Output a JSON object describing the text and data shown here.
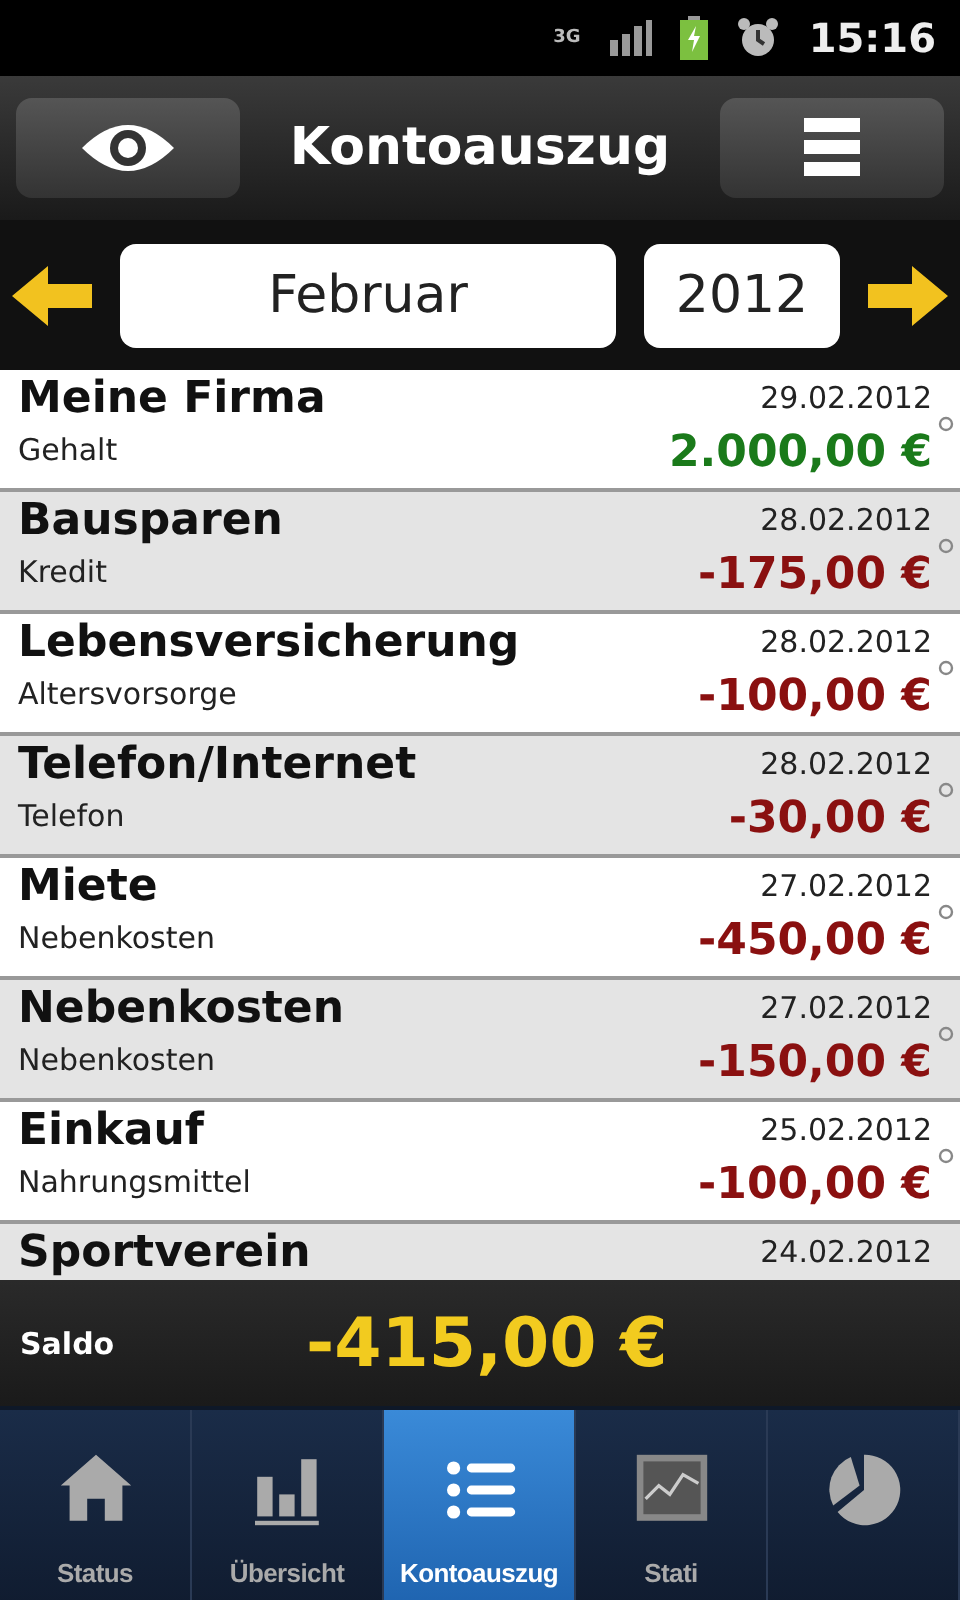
{
  "status_bar": {
    "network": "3G",
    "time": "15:16"
  },
  "toolbar": {
    "title": "Kontoauszug"
  },
  "period": {
    "month": "Februar",
    "year": "2012"
  },
  "transactions": [
    {
      "payee": "Meine Firma",
      "category": "Gehalt",
      "date": "29.02.2012",
      "amount": "2.000,00 €",
      "kind": "income"
    },
    {
      "payee": "Bausparen",
      "category": "Kredit",
      "date": "28.02.2012",
      "amount": "-175,00 €",
      "kind": "expense"
    },
    {
      "payee": "Lebensversicherung",
      "category": "Altersvorsorge",
      "date": "28.02.2012",
      "amount": "-100,00 €",
      "kind": "expense"
    },
    {
      "payee": "Telefon/Internet",
      "category": "Telefon",
      "date": "28.02.2012",
      "amount": "-30,00 €",
      "kind": "expense"
    },
    {
      "payee": "Miete",
      "category": "Nebenkosten",
      "date": "27.02.2012",
      "amount": "-450,00 €",
      "kind": "expense"
    },
    {
      "payee": "Nebenkosten",
      "category": "Nebenkosten",
      "date": "27.02.2012",
      "amount": "-150,00 €",
      "kind": "expense"
    },
    {
      "payee": "Einkauf",
      "category": "Nahrungsmittel",
      "date": "25.02.2012",
      "amount": "-100,00 €",
      "kind": "expense"
    },
    {
      "payee": "Sportverein",
      "date": "24.02.2012"
    }
  ],
  "saldo": {
    "label": "Saldo",
    "value": "-415,00 €"
  },
  "tabs": [
    {
      "label": "Status",
      "kind": "home",
      "selected": false
    },
    {
      "label": "Übersicht",
      "kind": "bars",
      "selected": false
    },
    {
      "label": "Kontoauszug",
      "kind": "list",
      "selected": true
    },
    {
      "label": "Stati",
      "kind": "chart",
      "selected": false
    },
    {
      "kind": "pie",
      "selected": false
    }
  ]
}
